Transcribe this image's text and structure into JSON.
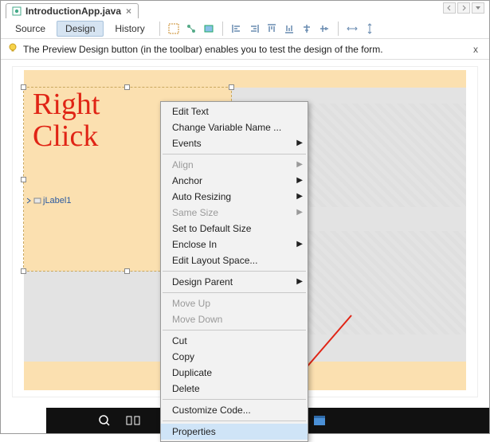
{
  "file_tab": {
    "name": "IntroductionApp.java"
  },
  "mode_tabs": {
    "source": "Source",
    "design": "Design",
    "history": "History"
  },
  "hint": {
    "text": "The Preview Design button (in the toolbar) enables you to test the design of the form.",
    "close": "x"
  },
  "label": {
    "text": "jLabel1"
  },
  "annotation": {
    "line1": "Right",
    "line2": "Click"
  },
  "context_menu": {
    "edit_text": "Edit Text",
    "change_var": "Change Variable Name ...",
    "events": "Events",
    "align": "Align",
    "anchor": "Anchor",
    "auto_resizing": "Auto Resizing",
    "same_size": "Same Size",
    "set_default": "Set to Default Size",
    "enclose_in": "Enclose In",
    "edit_layout": "Edit Layout Space...",
    "design_parent": "Design Parent",
    "move_up": "Move Up",
    "move_down": "Move Down",
    "cut": "Cut",
    "copy": "Copy",
    "duplicate": "Duplicate",
    "delete": "Delete",
    "customize": "Customize Code...",
    "properties": "Properties"
  }
}
